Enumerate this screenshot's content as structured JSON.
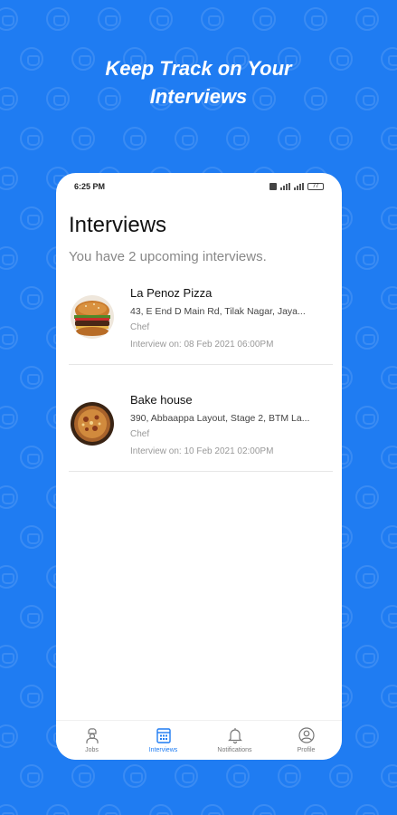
{
  "promo": {
    "headline_line1": "Keep Track on Your",
    "headline_line2": "Interviews"
  },
  "status_bar": {
    "time": "6:25 PM",
    "battery": "77"
  },
  "screen": {
    "title": "Interviews",
    "subtitle": "You have 2 upcoming interviews."
  },
  "interviews": [
    {
      "restaurant": "La Penoz Pizza",
      "address": "43, E End D Main Rd, Tilak Nagar, Jaya...",
      "role": "Chef",
      "interview_on": "Interview on: 08 Feb 2021 06:00PM",
      "thumbnail_icon": "burger-photo"
    },
    {
      "restaurant": "Bake house",
      "address": "390, Abbaappa Layout, Stage 2, BTM La...",
      "role": "Chef",
      "interview_on": "Interview on: 10 Feb 2021 02:00PM",
      "thumbnail_icon": "pizza-photo"
    }
  ],
  "tabbar": {
    "tabs": [
      {
        "label": "Jobs",
        "icon": "chef-icon"
      },
      {
        "label": "Interviews",
        "icon": "calendar-icon"
      },
      {
        "label": "Notifications",
        "icon": "bell-icon"
      },
      {
        "label": "Profile",
        "icon": "profile-icon"
      }
    ],
    "active_index": 1
  },
  "colors": {
    "brand_blue": "#1f7cf2",
    "card_bg": "#ffffff",
    "muted_text": "#999999"
  }
}
